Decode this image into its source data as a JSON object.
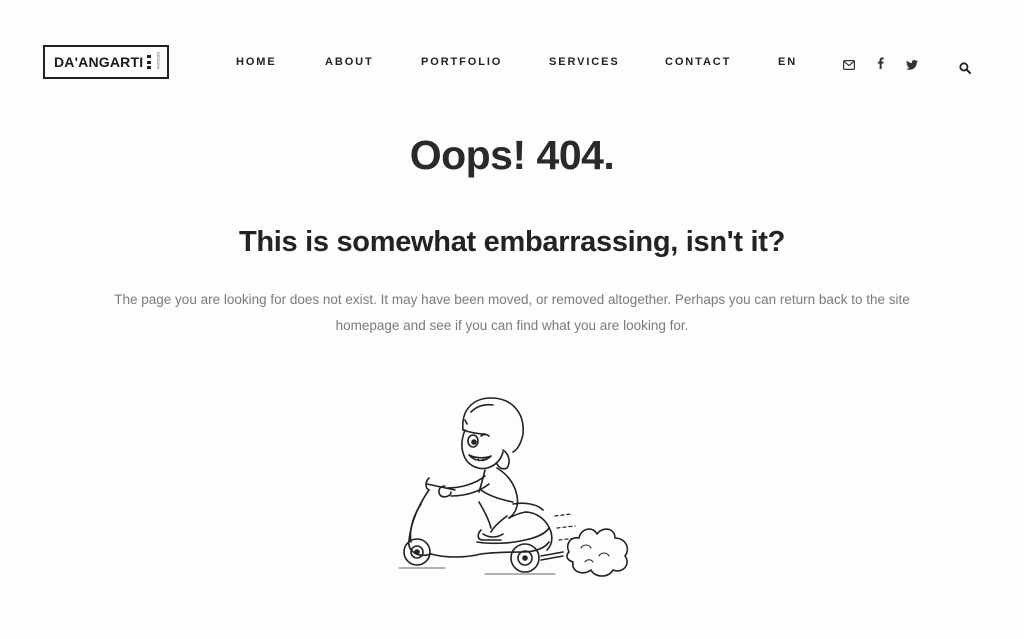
{
  "header": {
    "logo_text": "DA'ANGARTI",
    "logo_sub": "DESIGN",
    "nav": [
      {
        "label": "HOME"
      },
      {
        "label": "ABOUT"
      },
      {
        "label": "PORTFOLIO"
      },
      {
        "label": "SERVICES"
      },
      {
        "label": "CONTACT"
      },
      {
        "label": "EN"
      }
    ],
    "social_icons": [
      "envelope-icon",
      "facebook-icon",
      "twitter-icon"
    ],
    "search_icon": "search-icon"
  },
  "content": {
    "title": "Oops! 404.",
    "subtitle": "This is somewhat embarrassing, isn't it?",
    "line1": "The page you are looking for does not exist. It may have been moved, or removed altogether. Perhaps you can return back to the site",
    "line2": "homepage and see if you can find what you are looking for.",
    "illustration": "scooter-rider-illustration"
  }
}
